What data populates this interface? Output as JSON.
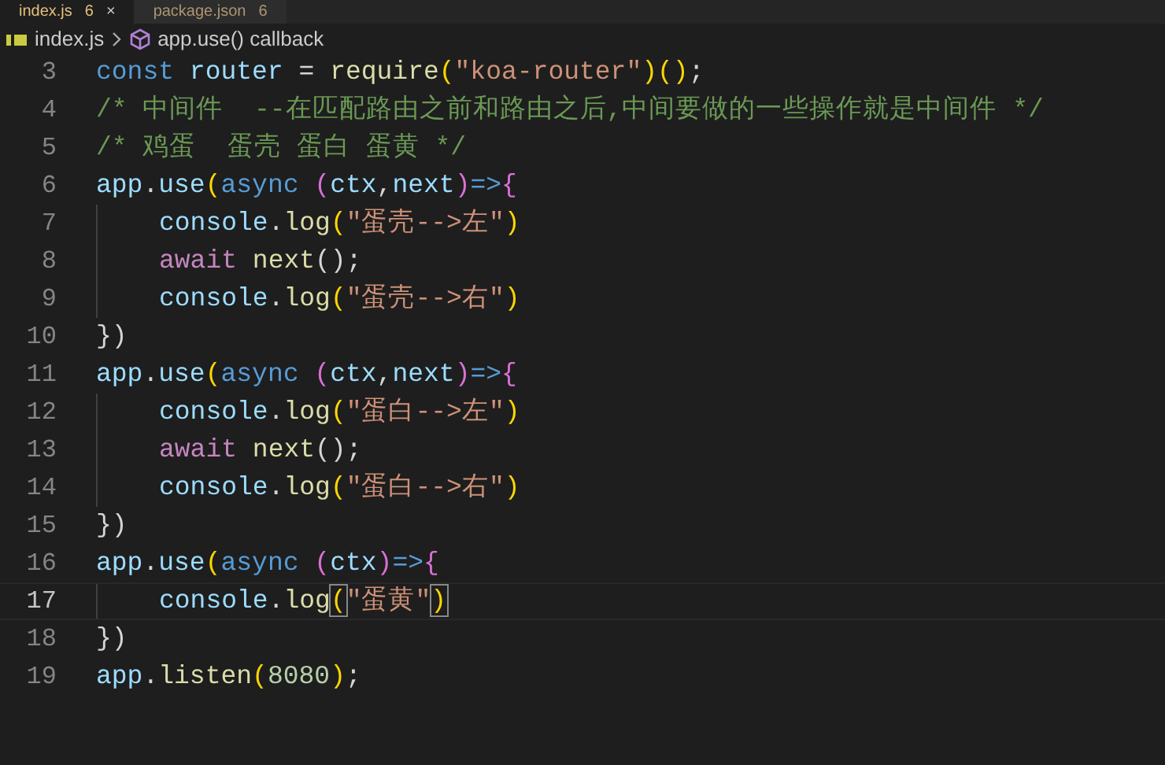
{
  "tabs": [
    {
      "label": "index.js",
      "count": "6",
      "selected": true,
      "close": "×"
    },
    {
      "label": "package.json",
      "count": "6",
      "selected": false
    }
  ],
  "breadcrumb": {
    "file": "index.js",
    "symbol": "app.use() callback"
  },
  "lines": [
    {
      "number": "3",
      "current": false,
      "indented": false,
      "tokens": [
        {
          "t": "const ",
          "kind": "keyword"
        },
        {
          "t": "router",
          "kind": "variable"
        },
        {
          "t": " = ",
          "kind": "plain"
        },
        {
          "t": "require",
          "kind": "function"
        },
        {
          "t": "(",
          "kind": "bracket"
        },
        {
          "t": "\"koa-router\"",
          "kind": "string"
        },
        {
          "t": ")()",
          "kind": "bracket"
        },
        {
          "t": ";",
          "kind": "plain"
        }
      ]
    },
    {
      "number": "4",
      "current": false,
      "indented": false,
      "tokens": [
        {
          "t": "/* 中间件  --在匹配路由之前和路由之后,中间要做的一些操作就是中间件 */",
          "kind": "comment"
        }
      ]
    },
    {
      "number": "5",
      "current": false,
      "indented": false,
      "tokens": [
        {
          "t": "/* 鸡蛋  蛋壳 蛋白 蛋黄 */",
          "kind": "comment"
        }
      ]
    },
    {
      "number": "6",
      "current": false,
      "indented": false,
      "tokens": [
        {
          "t": "app",
          "kind": "variable"
        },
        {
          "t": ".",
          "kind": "plain"
        },
        {
          "t": "use",
          "kind": "variable"
        },
        {
          "t": "(",
          "kind": "bracket"
        },
        {
          "t": "async ",
          "kind": "keyword"
        },
        {
          "t": "(",
          "kind": "bracket2"
        },
        {
          "t": "ctx",
          "kind": "variable"
        },
        {
          "t": ",",
          "kind": "plain"
        },
        {
          "t": "next",
          "kind": "variable"
        },
        {
          "t": ")",
          "kind": "bracket2"
        },
        {
          "t": "=>",
          "kind": "keyword"
        },
        {
          "t": "{",
          "kind": "bracket2"
        }
      ]
    },
    {
      "number": "7",
      "current": false,
      "indented": true,
      "tokens": [
        {
          "t": "console",
          "kind": "variable"
        },
        {
          "t": ".",
          "kind": "plain"
        },
        {
          "t": "log",
          "kind": "function"
        },
        {
          "t": "(",
          "kind": "bracket"
        },
        {
          "t": "\"蛋壳-->左\"",
          "kind": "string"
        },
        {
          "t": ")",
          "kind": "bracket"
        }
      ]
    },
    {
      "number": "8",
      "current": false,
      "indented": true,
      "tokens": [
        {
          "t": "await ",
          "kind": "control"
        },
        {
          "t": "next",
          "kind": "function"
        },
        {
          "t": "();",
          "kind": "plain"
        }
      ]
    },
    {
      "number": "9",
      "current": false,
      "indented": true,
      "tokens": [
        {
          "t": "console",
          "kind": "variable"
        },
        {
          "t": ".",
          "kind": "plain"
        },
        {
          "t": "log",
          "kind": "function"
        },
        {
          "t": "(",
          "kind": "bracket"
        },
        {
          "t": "\"蛋壳-->右\"",
          "kind": "string"
        },
        {
          "t": ")",
          "kind": "bracket"
        }
      ]
    },
    {
      "number": "10",
      "current": false,
      "indented": false,
      "tokens": [
        {
          "t": "})",
          "kind": "plain"
        }
      ]
    },
    {
      "number": "11",
      "current": false,
      "indented": false,
      "tokens": [
        {
          "t": "app",
          "kind": "variable"
        },
        {
          "t": ".",
          "kind": "plain"
        },
        {
          "t": "use",
          "kind": "variable"
        },
        {
          "t": "(",
          "kind": "bracket"
        },
        {
          "t": "async ",
          "kind": "keyword"
        },
        {
          "t": "(",
          "kind": "bracket2"
        },
        {
          "t": "ctx",
          "kind": "variable"
        },
        {
          "t": ",",
          "kind": "plain"
        },
        {
          "t": "next",
          "kind": "variable"
        },
        {
          "t": ")",
          "kind": "bracket2"
        },
        {
          "t": "=>",
          "kind": "keyword"
        },
        {
          "t": "{",
          "kind": "bracket2"
        }
      ]
    },
    {
      "number": "12",
      "current": false,
      "indented": true,
      "tokens": [
        {
          "t": "console",
          "kind": "variable"
        },
        {
          "t": ".",
          "kind": "plain"
        },
        {
          "t": "log",
          "kind": "function"
        },
        {
          "t": "(",
          "kind": "bracket"
        },
        {
          "t": "\"蛋白-->左\"",
          "kind": "string"
        },
        {
          "t": ")",
          "kind": "bracket"
        }
      ]
    },
    {
      "number": "13",
      "current": false,
      "indented": true,
      "tokens": [
        {
          "t": "await ",
          "kind": "control"
        },
        {
          "t": "next",
          "kind": "function"
        },
        {
          "t": "();",
          "kind": "plain"
        }
      ]
    },
    {
      "number": "14",
      "current": false,
      "indented": true,
      "tokens": [
        {
          "t": "console",
          "kind": "variable"
        },
        {
          "t": ".",
          "kind": "plain"
        },
        {
          "t": "log",
          "kind": "function"
        },
        {
          "t": "(",
          "kind": "bracket"
        },
        {
          "t": "\"蛋白-->右\"",
          "kind": "string"
        },
        {
          "t": ")",
          "kind": "bracket"
        }
      ]
    },
    {
      "number": "15",
      "current": false,
      "indented": false,
      "tokens": [
        {
          "t": "})",
          "kind": "plain"
        }
      ]
    },
    {
      "number": "16",
      "current": false,
      "indented": false,
      "tokens": [
        {
          "t": "app",
          "kind": "variable"
        },
        {
          "t": ".",
          "kind": "plain"
        },
        {
          "t": "use",
          "kind": "variable"
        },
        {
          "t": "(",
          "kind": "bracket"
        },
        {
          "t": "async ",
          "kind": "keyword"
        },
        {
          "t": "(",
          "kind": "bracket2"
        },
        {
          "t": "ctx",
          "kind": "variable"
        },
        {
          "t": ")",
          "kind": "bracket2"
        },
        {
          "t": "=>",
          "kind": "keyword"
        },
        {
          "t": "{",
          "kind": "bracket2"
        }
      ]
    },
    {
      "number": "17",
      "current": true,
      "indented": true,
      "tokens": [
        {
          "t": "console",
          "kind": "variable"
        },
        {
          "t": ".",
          "kind": "plain"
        },
        {
          "t": "log",
          "kind": "function"
        },
        {
          "t": "(",
          "kind": "bracket",
          "matched": true
        },
        {
          "t": "\"蛋黄\"",
          "kind": "string"
        },
        {
          "t": ")",
          "kind": "bracket",
          "matched": true
        }
      ]
    },
    {
      "number": "18",
      "current": false,
      "indented": false,
      "tokens": [
        {
          "t": "})",
          "kind": "plain"
        }
      ]
    },
    {
      "number": "19",
      "current": false,
      "indented": false,
      "tokens": [
        {
          "t": "app",
          "kind": "variable"
        },
        {
          "t": ".",
          "kind": "plain"
        },
        {
          "t": "listen",
          "kind": "function"
        },
        {
          "t": "(",
          "kind": "bracket"
        },
        {
          "t": "8080",
          "kind": "number"
        },
        {
          "t": ")",
          "kind": "bracket"
        },
        {
          "t": ";",
          "kind": "plain"
        }
      ]
    }
  ]
}
